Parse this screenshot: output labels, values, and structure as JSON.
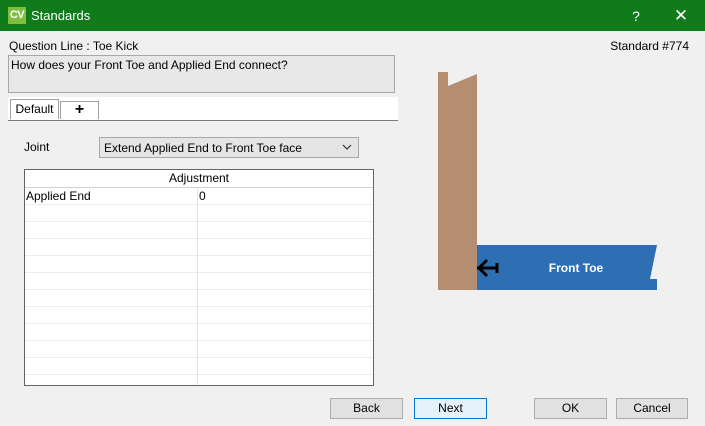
{
  "window": {
    "app_icon_text": "CV",
    "title": "Standards",
    "help_label": "?",
    "close_label": "✕"
  },
  "header": {
    "question_line": "Question Line : Toe Kick",
    "standard_number": "Standard #774",
    "question_text": "How does your Front Toe and Applied End connect?"
  },
  "tabs": {
    "default_label": "Default",
    "add_label": "+"
  },
  "joint": {
    "label": "Joint",
    "selected": "Extend Applied End to Front Toe face"
  },
  "grid": {
    "column_header": "Adjustment",
    "rows": [
      {
        "name": "Applied End",
        "value": "0"
      },
      {
        "name": "",
        "value": ""
      },
      {
        "name": "",
        "value": ""
      },
      {
        "name": "",
        "value": ""
      },
      {
        "name": "",
        "value": ""
      },
      {
        "name": "",
        "value": ""
      },
      {
        "name": "",
        "value": ""
      },
      {
        "name": "",
        "value": ""
      },
      {
        "name": "",
        "value": ""
      },
      {
        "name": "",
        "value": ""
      },
      {
        "name": "",
        "value": ""
      },
      {
        "name": "",
        "value": ""
      }
    ]
  },
  "figure": {
    "front_toe_label": "Front Toe",
    "colors": {
      "applied_end": "#b58e72",
      "front_toe": "#2e6fb4"
    }
  },
  "buttons": {
    "back": "Back",
    "next": "Next",
    "ok": "OK",
    "cancel": "Cancel"
  },
  "colors": {
    "titlebar": "#0f7b1b"
  }
}
